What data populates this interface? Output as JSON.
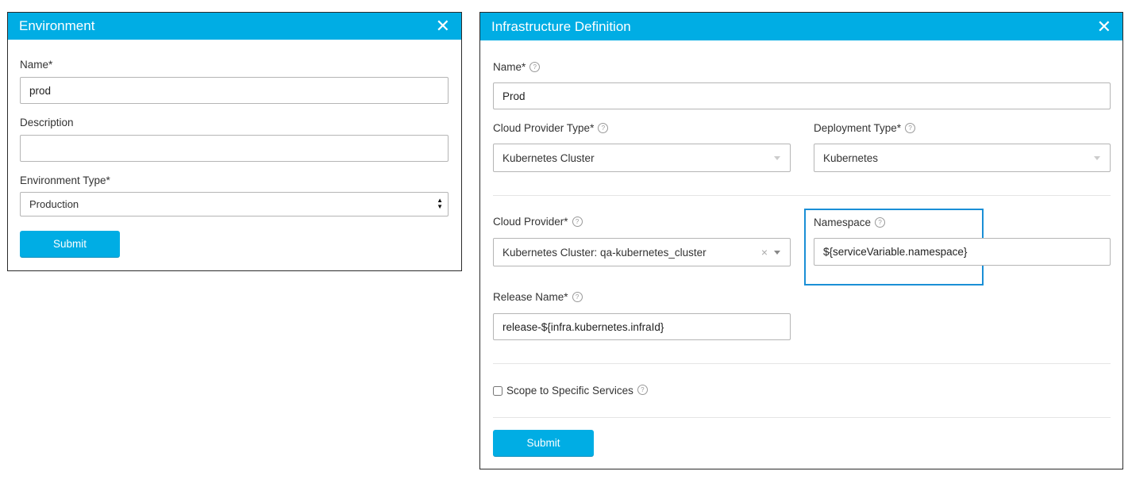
{
  "env_dialog": {
    "title": "Environment",
    "name_label": "Name*",
    "name_value": "prod",
    "description_label": "Description",
    "description_value": "",
    "env_type_label": "Environment Type*",
    "env_type_value": "Production",
    "submit_label": "Submit"
  },
  "infra_dialog": {
    "title": "Infrastructure Definition",
    "name_label": "Name*",
    "name_value": "Prod",
    "cloud_provider_type_label": "Cloud Provider Type*",
    "cloud_provider_type_value": "Kubernetes Cluster",
    "deployment_type_label": "Deployment Type*",
    "deployment_type_value": "Kubernetes",
    "cloud_provider_label": "Cloud Provider*",
    "cloud_provider_value": "Kubernetes Cluster: qa-kubernetes_cluster",
    "namespace_label": "Namespace",
    "namespace_value": "${serviceVariable.namespace}",
    "release_name_label": "Release Name*",
    "release_name_value": "release-${infra.kubernetes.infraId}",
    "scope_label": "Scope to Specific Services",
    "submit_label": "Submit"
  },
  "colors": {
    "header_blue": "#00ade4",
    "highlight_border": "#1a8fd6"
  },
  "icons": {
    "close": "close-icon",
    "help": "help-icon",
    "caret": "chevron-down-icon",
    "clear": "clear-icon"
  }
}
